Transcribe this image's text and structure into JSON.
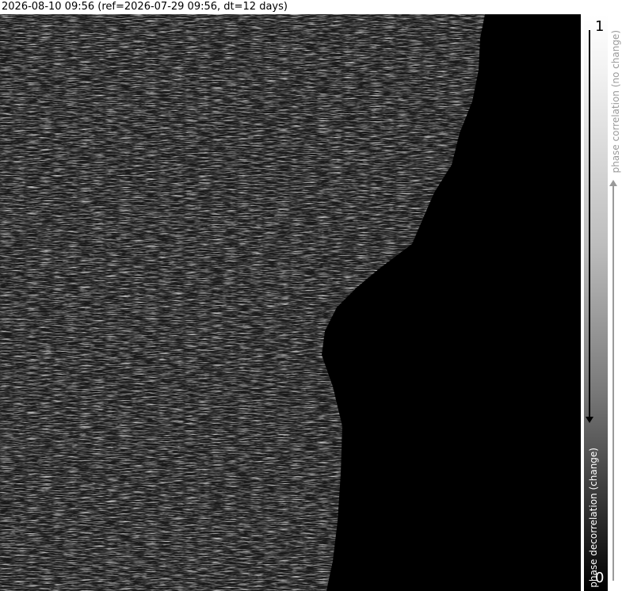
{
  "header": {
    "title": "2026-08-10 09:56 (ref=2026-07-29 09:56, dt=12 days)"
  },
  "colorbar": {
    "max_tick": "1",
    "min_tick": "0",
    "top_label": "phase correlation (no change)",
    "bottom_label": "phase decorrelation (change)"
  }
}
